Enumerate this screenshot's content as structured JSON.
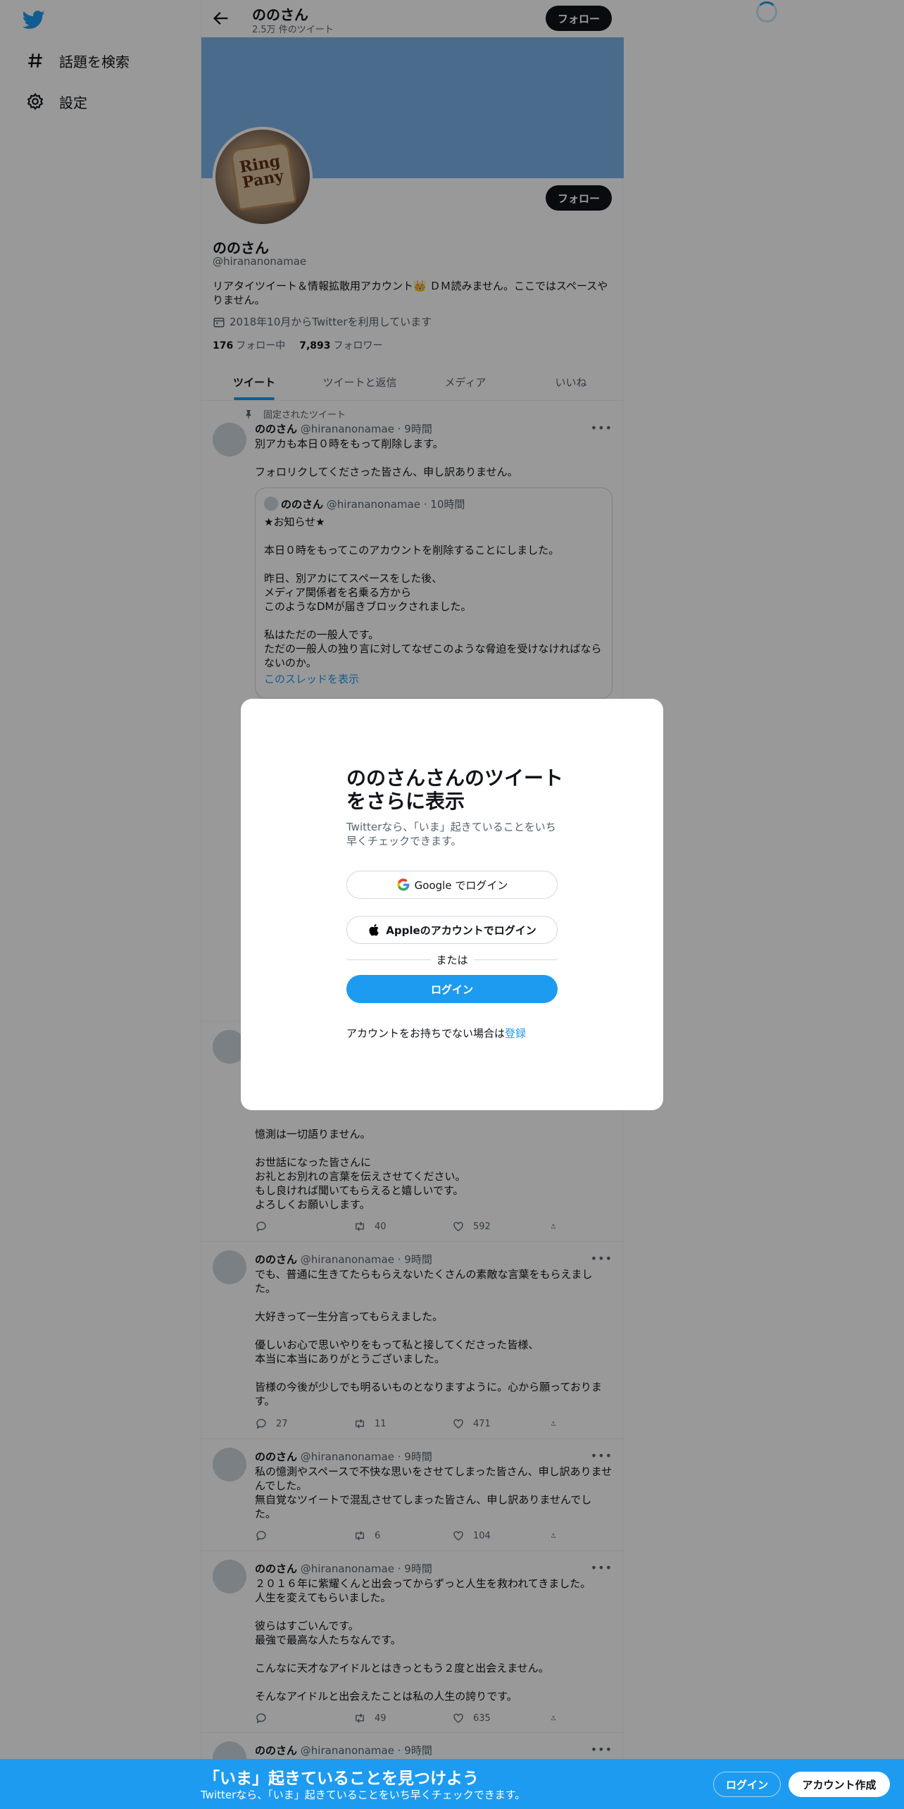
{
  "sidebar": {
    "items": [
      {
        "label": "話題を検索",
        "icon": "hashtag-icon"
      },
      {
        "label": "設定",
        "icon": "gear-icon"
      }
    ]
  },
  "topbar": {
    "name": "ののさん",
    "tweet_count": "2.5万 件のツイート",
    "follow_label": "フォロー"
  },
  "profile": {
    "follow_label": "フォロー",
    "name": "ののさん",
    "handle": "@hirananonamae",
    "bio": "リアタイツイート＆情報拡散用アカウント👑 ＤＭ読みません。ここではスペースやりません。",
    "joined": "2018年10月からTwitterを利用しています",
    "following_count": "176",
    "following_label": "フォロー中",
    "followers_count": "7,893",
    "followers_label": "フォロワー"
  },
  "tabs": [
    "ツイート",
    "ツイートと返信",
    "メディア",
    "いいね"
  ],
  "pinned_label": "固定されたツイート",
  "tweets": [
    {
      "name": "ののさん",
      "handle": "@hirananonamae",
      "time": "· 9時間",
      "body": "別アカも本日０時をもって削除します。\n\nフォロリクしてくださった皆さん、申し訳ありません。",
      "quote": {
        "name": "ののさん",
        "handle": "@hirananonamae",
        "time": "· 10時間",
        "body": "★お知らせ★\n\n本日０時をもってこのアカウントを削除することにしました。\n\n昨日、別アカにてスペースをした後、\nメディア関係者を名乗る方から\nこのようなDMが届きブロックされました。\n\n私はただの一般人です。\nただの一般人の独り言に対してなぜこのような脅迫を受けなければならないのか。",
        "link": "このスレッドを表示"
      }
    },
    {
      "body": "憶測は一切語りません。\n\nお世話になった皆さんに\nお礼とお別れの言葉を伝えさせてください。\nもし良ければ聞いてもらえると嬉しいです。\nよろしくお願いします。",
      "reply": "",
      "retweet": "40",
      "like": "592"
    },
    {
      "name": "ののさん",
      "handle": "@hirananonamae",
      "time": "· 9時間",
      "body": "でも、普通に生きてたらもらえないたくさんの素敵な言葉をもらえました。\n\n大好きって一生分言ってもらえました。\n\n優しいお心で思いやりをもって私と接してくださった皆様、\n本当に本当にありがとうございました。\n\n皆様の今後が少しでも明るいものとなりますように。心から願っております。",
      "reply": "27",
      "retweet": "11",
      "like": "471"
    },
    {
      "name": "ののさん",
      "handle": "@hirananonamae",
      "time": "· 9時間",
      "body": "私の憶測やスペースで不快な思いをさせてしまった皆さん、申し訳ありませんでした。\n無自覚なツイートで混乱させてしまった皆さん、申し訳ありませんでした。",
      "reply": "",
      "retweet": "6",
      "like": "104"
    },
    {
      "name": "ののさん",
      "handle": "@hirananonamae",
      "time": "· 9時間",
      "body": "２０１６年に紫耀くんと出会ってからずっと人生を救われてきました。\n人生を変えてもらいました。\n\n彼らはすごいんです。\n最強で最高な人たちなんです。\n\nこんなに天才なアイドルとはきっともう２度と出会えません。\n\nそんなアイドルと出会えたことは私の人生の誇りです。",
      "reply": "",
      "retweet": "49",
      "like": "635"
    },
    {
      "name": "ののさん",
      "handle": "@hirananonamae",
      "time": "· 9時間"
    }
  ],
  "modal": {
    "title": "ののさんさんのツイートをさらに表示",
    "subtitle": "Twitterなら、「いま」起きていることをいち早くチェックできます。",
    "google_label": "Google でログイン",
    "apple_label": "Appleのアカウントでログイン",
    "or_label": "または",
    "login_label": "ログイン",
    "signup_prompt": "アカウントをお持ちでない場合は",
    "signup_link": "登録"
  },
  "bottombar": {
    "title": "「いま」起きていることを見つけよう",
    "subtitle": "Twitterなら、「いま」起きていることをいち早くチェックできます。",
    "login_label": "ログイン",
    "signup_label": "アカウント作成"
  },
  "colors": {
    "accent": "#1d9bf0",
    "banner": "#7eb3e9",
    "text": "#0f1419",
    "secondary": "#536471"
  }
}
